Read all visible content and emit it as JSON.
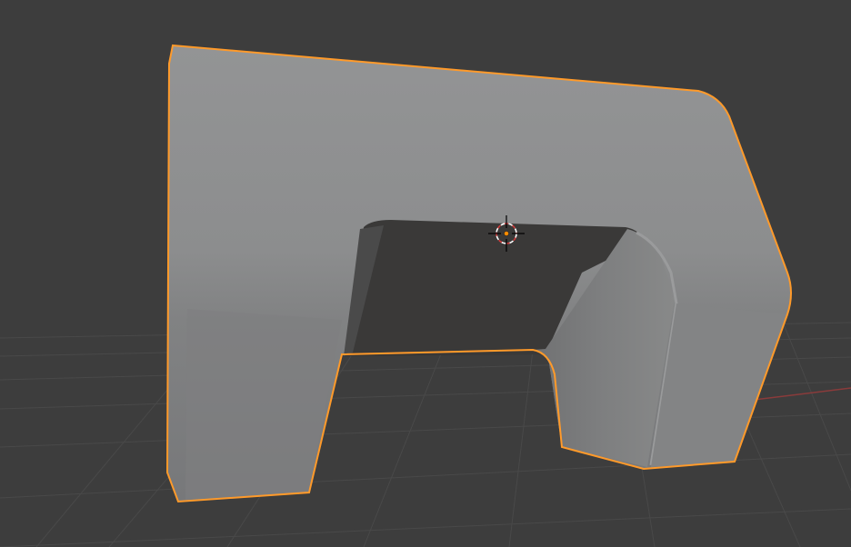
{
  "viewport": {
    "mode": "object-mode",
    "shading": "solid",
    "background_color": "#3d3d3d",
    "grid_color": "#4a4a4a",
    "x_axis_color": "#8a3b3b"
  },
  "scene": {
    "selected_object": {
      "shape": "arch",
      "selected": true,
      "outline_color": "#ff9a2a",
      "surface_color": "#8a8b8c"
    },
    "cursor_icon": "3d-cursor-icon",
    "origin_color": "#ff8c00"
  }
}
